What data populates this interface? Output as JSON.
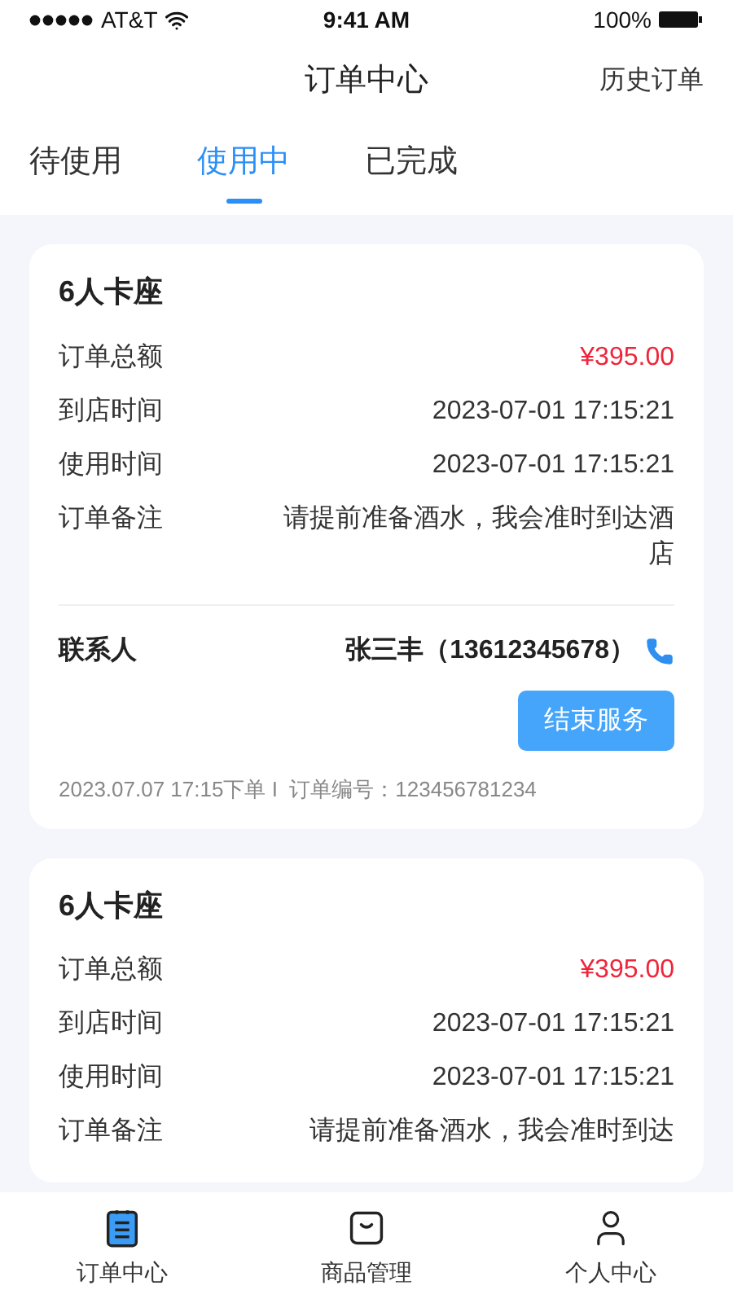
{
  "status_bar": {
    "carrier": "AT&T",
    "time": "9:41 AM",
    "battery": "100%"
  },
  "header": {
    "title": "订单中心",
    "action": "历史订单"
  },
  "tabs": [
    {
      "label": "待使用",
      "selected": false
    },
    {
      "label": "使用中",
      "selected": true
    },
    {
      "label": "已完成",
      "selected": false
    }
  ],
  "orders": [
    {
      "title": "6人卡座",
      "fields": [
        {
          "label": "订单总额",
          "value": "¥395.00",
          "kind": "price"
        },
        {
          "label": "到店时间",
          "value": "2023-07-01 17:15:21",
          "kind": "text"
        },
        {
          "label": "使用时间",
          "value": "2023-07-01 17:15:21",
          "kind": "text"
        },
        {
          "label": "订单备注",
          "value": "请提前准备酒水，我会准时到达酒店",
          "kind": "text"
        }
      ],
      "contact_label": "联系人",
      "contact": "张三丰（13612345678）",
      "button": "结束服务",
      "footer": "2023.07.07 17:15下单 I  订单编号：123456781234"
    },
    {
      "title": "6人卡座",
      "fields": [
        {
          "label": "订单总额",
          "value": "¥395.00",
          "kind": "price"
        },
        {
          "label": "到店时间",
          "value": "2023-07-01 17:15:21",
          "kind": "text"
        },
        {
          "label": "使用时间",
          "value": "2023-07-01 17:15:21",
          "kind": "text"
        },
        {
          "label": "订单备注",
          "value": "请提前准备酒水，我会准时到达",
          "kind": "text"
        }
      ]
    }
  ],
  "bottom_nav": [
    {
      "label": "订单中心",
      "selected": true,
      "kind": "orders"
    },
    {
      "label": "商品管理",
      "selected": false,
      "kind": "goods"
    },
    {
      "label": "个人中心",
      "selected": false,
      "kind": "profile"
    }
  ]
}
